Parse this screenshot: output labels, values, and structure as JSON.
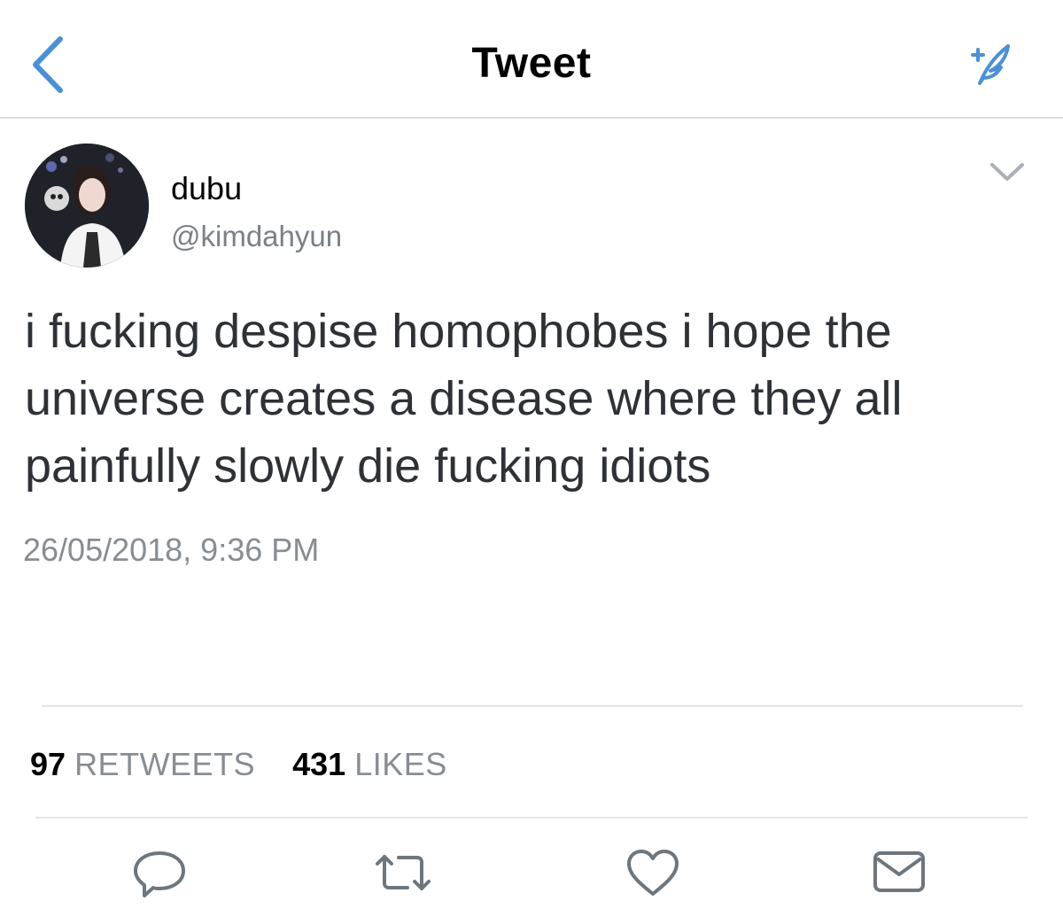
{
  "header": {
    "title": "Tweet",
    "back_icon": "chevron-left-icon",
    "compose_icon": "compose-tweet-feather-icon",
    "accent_color": "#4a90d9"
  },
  "tweet": {
    "author": {
      "display_name": "dubu",
      "handle": "@kimdahyun",
      "avatar_icon": "profile-photo"
    },
    "menu_icon": "chevron-down-icon",
    "text_lines": [
      "i fucking despise homophobes i hope the",
      "universe creates a disease where they all",
      "painfully slowly die fucking idiots"
    ],
    "timestamp": "26/05/2018, 9:36 PM",
    "stats": {
      "retweets_count": "97",
      "retweets_label": "RETWEETS",
      "likes_count": "431",
      "likes_label": "LIKES"
    }
  },
  "actions": [
    {
      "name": "reply",
      "icon": "reply-bubble-icon"
    },
    {
      "name": "retweet",
      "icon": "retweet-icon"
    },
    {
      "name": "like",
      "icon": "heart-icon"
    },
    {
      "name": "share",
      "icon": "envelope-icon"
    }
  ]
}
